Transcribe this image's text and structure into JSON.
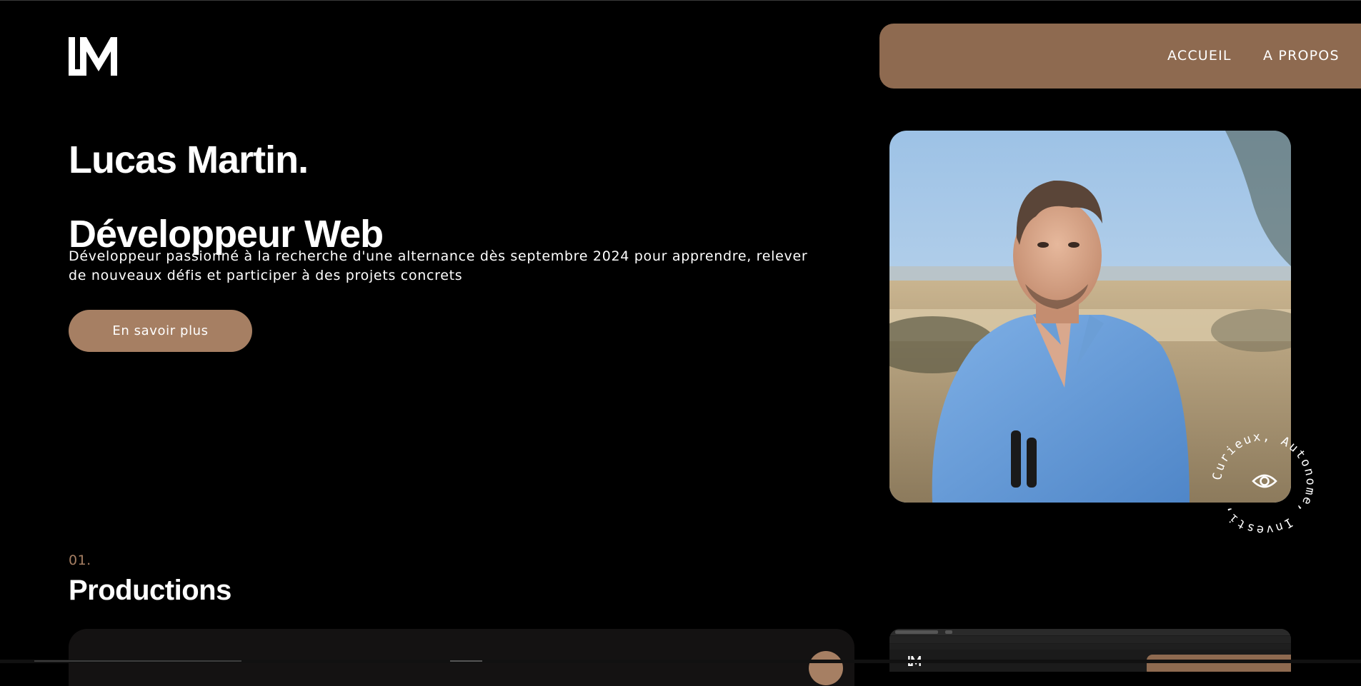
{
  "brand": {
    "logo_alt": "LM logo",
    "logo_icon": "lm-monogram-logo"
  },
  "nav": {
    "items": [
      {
        "label": "ACCUEIL"
      },
      {
        "label": "A PROPOS"
      }
    ]
  },
  "hero": {
    "title_line1": "Lucas Martin.",
    "title_line2": "Développeur Web",
    "description": "Développeur passionné à la recherche d'une alternance dès septembre 2024 pour apprendre, relever de nouveaux défis et participer à des projets concrets",
    "cta_label": "En savoir plus",
    "photo_alt": "Portrait de Lucas Martin"
  },
  "badge": {
    "rotating_text": "Curieux, Autonome, Investi, ",
    "icon": "eye-icon"
  },
  "productions": {
    "number": "01.",
    "title": "Productions"
  },
  "colors": {
    "accent": "#a67f63",
    "nav_background": "#8e6a50",
    "background": "#000000"
  }
}
